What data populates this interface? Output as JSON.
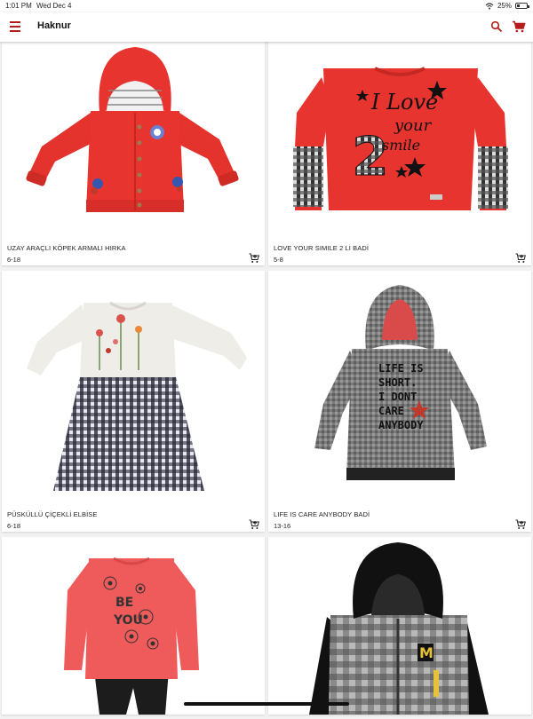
{
  "status": {
    "time": "1:01 PM",
    "date": "Wed Dec 4",
    "battery": "25%"
  },
  "app": {
    "title": "Haknur"
  },
  "products": [
    {
      "name": "UZAY ARAÇLI KÖPEK ARMALI HIRKA",
      "size": "6-18",
      "image_icon": "red-hooded-cardigan"
    },
    {
      "name": "LOVE YOUR SIMILE 2 Lİ BADİ",
      "size": "5-8",
      "image_icon": "red-sweatshirt-plaid-sleeves"
    },
    {
      "name": "PÜSKÜLLÜ ÇİÇEKLİ ELBİSE",
      "size": "6-18",
      "image_icon": "white-top-gingham-dress"
    },
    {
      "name": "LIFE IS CARE ANYBODY BADİ",
      "size": "13-16",
      "image_icon": "grey-hooded-tunic"
    },
    {
      "name": "",
      "size": "",
      "image_icon": "coral-top-black-leggings"
    },
    {
      "name": "",
      "size": "",
      "image_icon": "black-hoodie-plaid-vest"
    }
  ],
  "artwork": {
    "love_line1": "I Love",
    "love_line2": "your",
    "love_line3": "smile",
    "love_number": "2",
    "life_line1": "LIFE IS",
    "life_line2": "SHORT.",
    "life_line3": "I DONT",
    "life_line4": "CARE",
    "life_line5": "ANYBODY",
    "be_line1": "BE",
    "be_line2": "YOU",
    "hoodie_letter": "M"
  },
  "colors": {
    "accent": "#b71c1c",
    "red_garment": "#e8342f",
    "coral": "#ef5a5a"
  }
}
